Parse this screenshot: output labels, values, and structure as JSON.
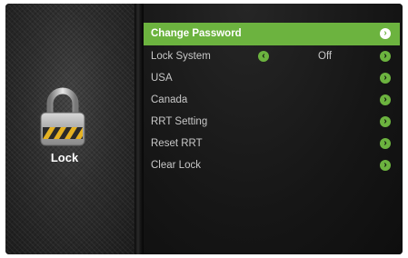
{
  "side_panel": {
    "title": "Lock"
  },
  "menu": {
    "items": [
      {
        "label": "Change Password",
        "selected": true
      },
      {
        "label": "Lock System",
        "value": "Off"
      },
      {
        "label": "USA"
      },
      {
        "label": "Canada"
      },
      {
        "label": "RRT Setting"
      },
      {
        "label": "Reset RRT"
      },
      {
        "label": "Clear Lock"
      }
    ]
  },
  "icons": {
    "arrow_right": "›",
    "arrow_left": "‹",
    "lock": "padlock-icon"
  },
  "colors": {
    "accent": "#6cb33f"
  }
}
